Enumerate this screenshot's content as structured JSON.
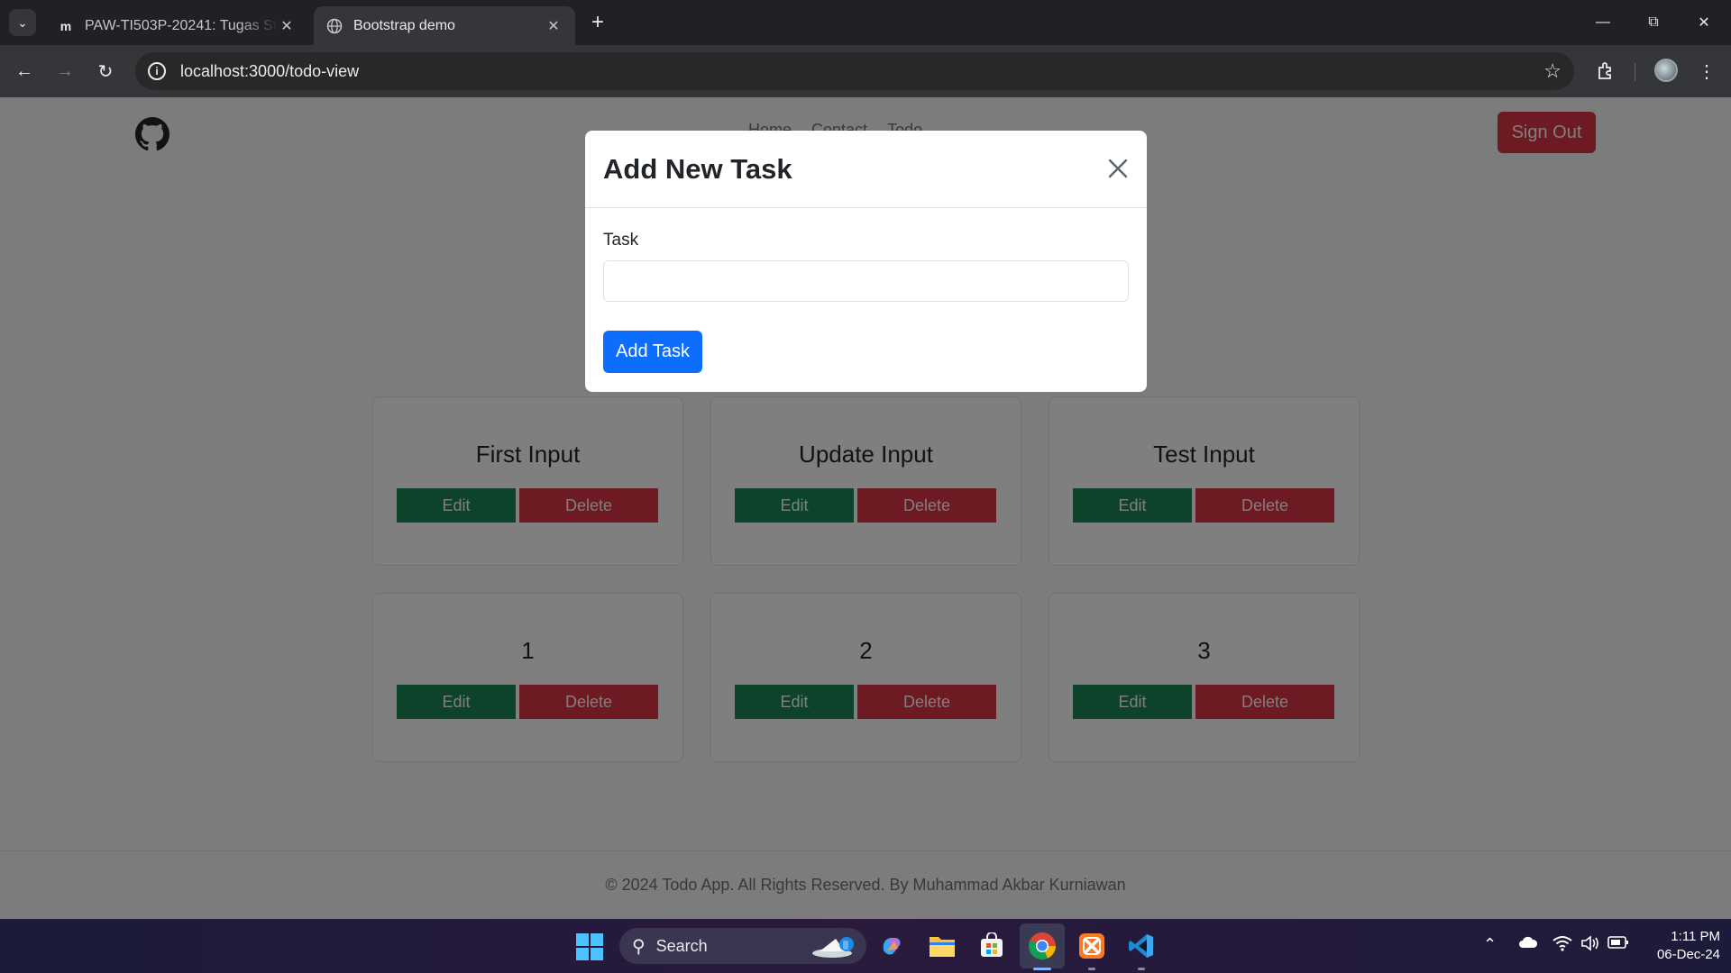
{
  "browser": {
    "tabs": [
      {
        "title": "PAW-TI503P-20241: Tugas Styling",
        "favicon": "m"
      },
      {
        "title": "Bootstrap demo"
      }
    ],
    "url": "localhost:3000/todo-view"
  },
  "navbar": {
    "links": [
      "Home",
      "Contact",
      "Todo"
    ],
    "signout_label": "Sign Out"
  },
  "cards": [
    {
      "title": "First Input",
      "edit": "Edit",
      "delete": "Delete"
    },
    {
      "title": "Update Input",
      "edit": "Edit",
      "delete": "Delete"
    },
    {
      "title": "Test Input",
      "edit": "Edit",
      "delete": "Delete"
    },
    {
      "title": "1",
      "edit": "Edit",
      "delete": "Delete"
    },
    {
      "title": "2",
      "edit": "Edit",
      "delete": "Delete"
    },
    {
      "title": "3",
      "edit": "Edit",
      "delete": "Delete"
    }
  ],
  "modal": {
    "title": "Add New Task",
    "label": "Task",
    "value": "",
    "button": "Add Task"
  },
  "footer": {
    "text": "© 2024 Todo App. All Rights Reserved. By Muhammad Akbar Kurniawan"
  },
  "taskbar": {
    "search_label": "Search",
    "time": "1:11 PM",
    "date": "06-Dec-24"
  },
  "colors": {
    "primary": "#0d6efd",
    "success": "#198754",
    "danger": "#dc3545"
  },
  "icons": [
    "github-icon",
    "close-icon",
    "windows-start-icon",
    "chrome-icon",
    "vscode-icon",
    "xampp-icon",
    "file-explorer-icon",
    "store-icon",
    "copilot-icon"
  ]
}
